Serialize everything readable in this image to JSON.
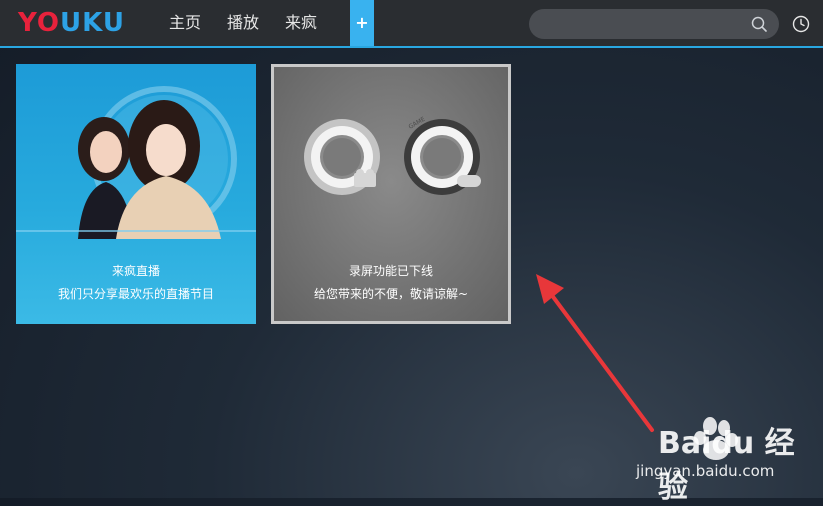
{
  "app": {
    "logo": "YOUKU"
  },
  "nav": {
    "items": [
      {
        "label": "主页"
      },
      {
        "label": "播放"
      },
      {
        "label": "来疯"
      }
    ],
    "plus_label": "+"
  },
  "search": {
    "value": "",
    "placeholder": ""
  },
  "icons": {
    "search": "search-icon",
    "history": "clock-icon"
  },
  "tiles": [
    {
      "title": "来疯直播",
      "subtitle": "我们只分享最欢乐的直播节目"
    },
    {
      "title": "录屏功能已下线",
      "subtitle": "给您带来的不便，敬请谅解~"
    }
  ],
  "watermark": {
    "brand": "Baidu 经验",
    "url": "jingyan.baidu.com"
  },
  "colors": {
    "topbar": "#2a2d31",
    "accent": "#29a7e1",
    "logo_red": "#e8223c",
    "logo_blue": "#2da2e6",
    "arrow": "#e8373a"
  }
}
